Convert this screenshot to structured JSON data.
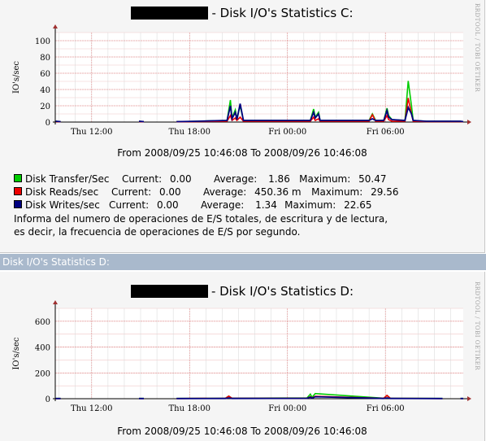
{
  "graph_c": {
    "title": "- Disk I/O's Statistics C:",
    "range_text": "From 2008/09/25 10:46:08 To 2008/09/26 10:46:08",
    "watermark": "RRDTOOL / TOBI OETIKER",
    "legend": [
      {
        "name": "Disk Transfer/Sec",
        "current_label": "Current:",
        "current": "0.00",
        "average_label": "Average:",
        "average": "1.86",
        "maximum_label": "Maximum:",
        "maximum": "50.47",
        "color": "#00cc00"
      },
      {
        "name": "Disk Reads/sec",
        "current_label": "Current:",
        "current": "0.00",
        "average_label": "Average:",
        "average": "450.36 m",
        "maximum_label": "Maximum:",
        "maximum": "29.56",
        "color": "#ee0000"
      },
      {
        "name": "Disk Writes/sec",
        "current_label": "Current:",
        "current": "0.00",
        "average_label": "Average:",
        "average": "1.34",
        "maximum_label": "Maximum:",
        "maximum": "22.65",
        "color": "#000080"
      }
    ],
    "description_line1": "Informa del numero de operaciones de E/S totales, de escritura y de lectura,",
    "description_line2": "es decir, la frecuencia de operaciones de E/S por segundo."
  },
  "section_header": "Disk I/O's Statistics D:",
  "graph_d": {
    "title": "- Disk I/O's Statistics D:",
    "range_text": "From 2008/09/25 10:46:08 To 2008/09/26 10:46:08",
    "watermark": "RRDTOOL / TOBI OETIKER"
  },
  "chart_data": [
    {
      "type": "line",
      "title": "- Disk I/O's Statistics C:",
      "ylabel": "IO's/sec",
      "xlabel": "",
      "ylim": [
        0,
        110
      ],
      "xlim": [
        9.77,
        34.77
      ],
      "yticks": [
        0,
        20,
        40,
        60,
        80,
        100
      ],
      "xticks": [
        {
          "x": 12,
          "label": "Thu 12:00"
        },
        {
          "x": 18,
          "label": "Thu 18:00"
        },
        {
          "x": 24,
          "label": "Fri 00:00"
        },
        {
          "x": 30,
          "label": "Fri 06:00"
        }
      ],
      "grid": true,
      "legend_position": "bottom",
      "gaps": [
        [
          10.3,
          14.9
        ],
        [
          15.3,
          17.2
        ],
        [
          34.1,
          34.6
        ]
      ],
      "series": [
        {
          "name": "Disk Transfer/Sec",
          "color": "#00cc00",
          "x": [
            9.8,
            10.1,
            14.9,
            15.2,
            17.2,
            18.5,
            20.3,
            20.5,
            20.6,
            20.8,
            20.9,
            21.1,
            21.3,
            25.4,
            25.6,
            25.7,
            25.9,
            26.0,
            29.0,
            29.2,
            29.4,
            29.9,
            30.1,
            30.2,
            30.4,
            31.2,
            31.4,
            31.6,
            31.7,
            32.5,
            34.6,
            34.77
          ],
          "y": [
            1,
            0.5,
            1,
            0.5,
            0.5,
            1,
            2,
            27,
            5,
            15,
            4,
            20,
            2,
            2,
            16,
            6,
            12,
            2,
            2,
            10,
            2,
            2,
            17,
            8,
            3,
            2,
            50.5,
            20,
            2,
            1,
            1,
            0.5
          ]
        },
        {
          "name": "Disk Reads/sec",
          "color": "#ee0000",
          "x": [
            9.8,
            10.1,
            14.9,
            15.2,
            17.2,
            18.5,
            20.3,
            20.5,
            20.6,
            20.8,
            20.9,
            21.1,
            21.3,
            25.4,
            25.6,
            25.7,
            25.9,
            26.0,
            29.0,
            29.2,
            29.4,
            29.9,
            30.1,
            30.2,
            30.4,
            31.2,
            31.4,
            31.6,
            31.7,
            32.5,
            34.6,
            34.77
          ],
          "y": [
            0.5,
            0.3,
            0.5,
            0.3,
            0.3,
            0.5,
            1,
            8,
            2,
            5,
            2,
            6,
            1,
            1,
            6,
            2,
            4,
            1,
            1,
            9,
            1,
            1,
            8,
            3,
            1,
            1,
            29.5,
            10,
            1,
            0.5,
            0.5,
            0.3
          ]
        },
        {
          "name": "Disk Writes/sec",
          "color": "#000080",
          "x": [
            9.8,
            10.1,
            14.9,
            15.2,
            17.2,
            18.5,
            20.3,
            20.5,
            20.6,
            20.8,
            20.9,
            21.1,
            21.3,
            25.4,
            25.6,
            25.7,
            25.9,
            26.0,
            29.0,
            29.2,
            29.4,
            29.9,
            30.1,
            30.2,
            30.4,
            31.2,
            31.4,
            31.6,
            31.7,
            32.5,
            34.6,
            34.77
          ],
          "y": [
            1,
            0.5,
            1,
            0.5,
            0.5,
            1,
            2,
            20,
            4,
            12,
            3,
            22.6,
            2,
            2,
            12,
            5,
            10,
            2,
            2,
            4,
            2,
            2,
            14,
            6,
            3,
            2,
            18,
            10,
            2,
            1,
            1,
            0.5
          ]
        }
      ]
    },
    {
      "type": "line",
      "title": "- Disk I/O's Statistics D:",
      "ylabel": "IO's/sec",
      "xlabel": "",
      "ylim": [
        0,
        700
      ],
      "xlim": [
        9.77,
        34.77
      ],
      "yticks": [
        0,
        200,
        400,
        600
      ],
      "xticks": [
        {
          "x": 12,
          "label": "Thu 12:00"
        },
        {
          "x": 18,
          "label": "Thu 18:00"
        },
        {
          "x": 24,
          "label": "Fri 00:00"
        },
        {
          "x": 30,
          "label": "Fri 06:00"
        }
      ],
      "grid": true,
      "gaps": [
        [
          10.3,
          14.9
        ],
        [
          15.3,
          17.2
        ],
        [
          33.5,
          34.6
        ]
      ],
      "series": [
        {
          "name": "",
          "color": "#00cc00",
          "x": [
            9.8,
            10.1,
            14.9,
            15.2,
            17.2,
            20.2,
            20.4,
            20.6,
            25.2,
            25.4,
            25.5,
            25.7,
            29.9,
            30.1,
            30.3,
            33.5,
            34.6,
            34.77
          ],
          "y": [
            2,
            2,
            2,
            2,
            2,
            4,
            20,
            4,
            6,
            35,
            10,
            40,
            4,
            25,
            4,
            2,
            2,
            2
          ]
        },
        {
          "name": "",
          "color": "#ee0000",
          "x": [
            9.8,
            10.1,
            14.9,
            15.2,
            17.2,
            20.2,
            20.4,
            20.6,
            25.2,
            25.4,
            25.5,
            25.7,
            29.9,
            30.1,
            30.3,
            33.5,
            34.6,
            34.77
          ],
          "y": [
            1,
            1,
            1,
            1,
            1,
            3,
            20,
            3,
            3,
            15,
            5,
            18,
            3,
            25,
            3,
            1,
            1,
            1
          ]
        },
        {
          "name": "",
          "color": "#000080",
          "x": [
            9.8,
            10.1,
            14.9,
            15.2,
            17.2,
            20.2,
            20.4,
            20.6,
            25.2,
            25.4,
            25.5,
            25.7,
            29.9,
            30.1,
            30.3,
            33.5,
            34.6,
            34.77
          ],
          "y": [
            1,
            1,
            1,
            1,
            1,
            2,
            6,
            2,
            3,
            12,
            4,
            15,
            2,
            6,
            2,
            1,
            1,
            1
          ]
        }
      ]
    }
  ]
}
